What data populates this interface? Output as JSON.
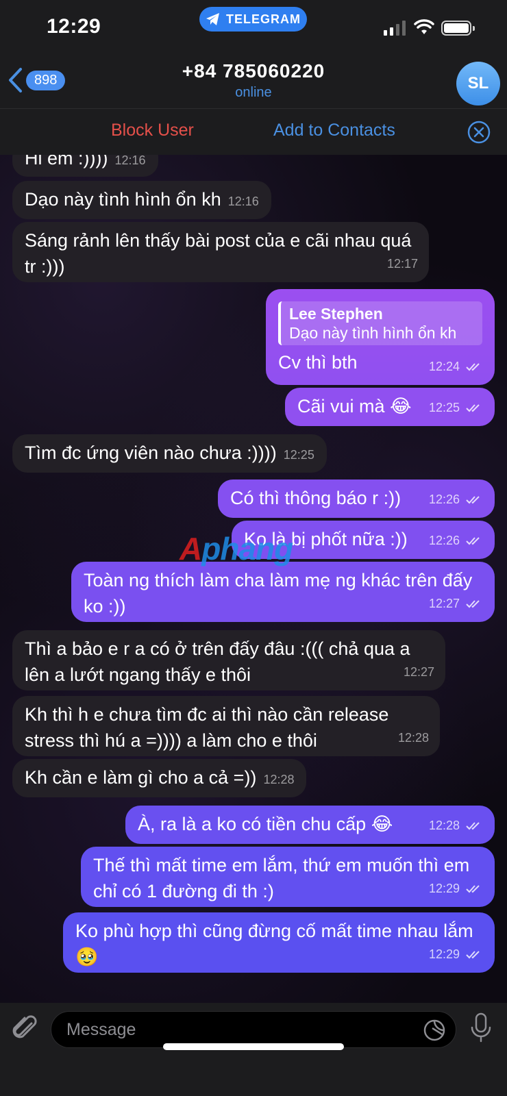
{
  "status_bar": {
    "time": "12:29",
    "app_pill": "TELEGRAM"
  },
  "header": {
    "back_count": "898",
    "title": "+84 785060220",
    "subtitle": "online",
    "avatar_initials": "SL"
  },
  "actions": {
    "block": "Block User",
    "add": "Add to Contacts"
  },
  "messages": [
    {
      "dir": "in",
      "text": "Hi em :))))",
      "time": "12:16"
    },
    {
      "dir": "in",
      "text": "Dạo này tình hình ổn kh",
      "time": "12:16"
    },
    {
      "dir": "in",
      "text": "Sáng rảnh lên thấy bài post của e cãi nhau quá tr :)))",
      "time": "12:17"
    },
    {
      "dir": "out",
      "reply_name": "Lee Stephen",
      "reply_text": "Dạo này tình hình ổn kh",
      "text": "Cv thì bth",
      "time": "12:24"
    },
    {
      "dir": "out",
      "text": "Cãi vui mà 😂",
      "time": "12:25"
    },
    {
      "dir": "in",
      "text": "Tìm đc ứng viên nào chưa :))))",
      "time": "12:25"
    },
    {
      "dir": "out",
      "text": "Có thì thông báo r :))",
      "time": "12:26"
    },
    {
      "dir": "out",
      "text": "Ko là bị phốt nữa :))",
      "time": "12:26"
    },
    {
      "dir": "out",
      "text": "Toàn ng thích làm cha làm mẹ ng khác trên đấy ko :))",
      "time": "12:27"
    },
    {
      "dir": "in",
      "text": "Thì a bảo e r a có ở trên đấy đâu :((( chả qua a lên a lướt ngang thấy e thôi",
      "time": "12:27"
    },
    {
      "dir": "in",
      "text": "Kh thì h e chưa tìm đc ai thì nào cần release stress thì hú a =)))) a làm cho e thôi",
      "time": "12:28"
    },
    {
      "dir": "in",
      "text": "Kh cần e làm gì cho a cả =))",
      "time": "12:28"
    },
    {
      "dir": "out",
      "text": "À, ra là a ko có tiền chu cấp 😂",
      "time": "12:28"
    },
    {
      "dir": "out",
      "text": "Thế thì mất time em lắm, thứ em muốn thì em chỉ có 1 đường đi th :)",
      "time": "12:29"
    },
    {
      "dir": "out",
      "text": "Ko phù hợp thì cũng đừng cố mất time nhau lắm 🥹",
      "time": "12:29"
    }
  ],
  "watermark": {
    "part1": "A",
    "part2": "phang"
  },
  "composer": {
    "placeholder": "Message"
  },
  "colors": {
    "accent": "#4a90e2",
    "danger": "#e5504a",
    "outgoing_top": "#9a4ff0",
    "outgoing_bottom": "#5a4ff0",
    "incoming": "#232026"
  }
}
